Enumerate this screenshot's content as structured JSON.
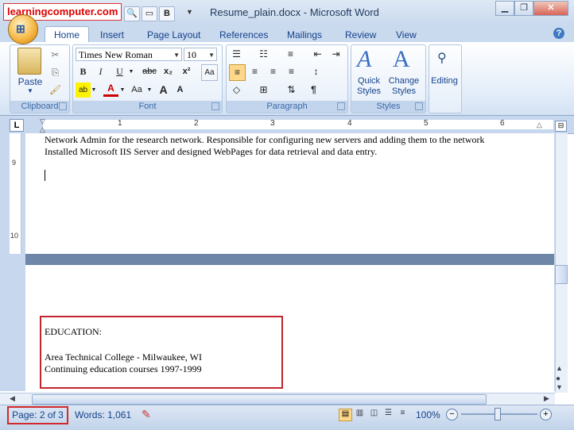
{
  "title_bar": {
    "watermark": "learningcomputer.com",
    "document_title": "Resume_plain.docx - Microsoft Word",
    "qat_bold": "B",
    "window_controls": [
      "minimize-icon",
      "restore-icon",
      "close-icon"
    ]
  },
  "ribbon_tabs": [
    "Home",
    "Insert",
    "Page Layout",
    "References",
    "Mailings",
    "Review",
    "View"
  ],
  "clipboard": {
    "paste_label": "Paste",
    "group_label": "Clipboard"
  },
  "font": {
    "font_name": "Times New Roman",
    "font_size": "10",
    "bold": "B",
    "italic": "I",
    "underline": "U",
    "strikethrough": "abc",
    "subscript": "x₂",
    "superscript": "x²",
    "group_label": "Font"
  },
  "paragraph": {
    "group_label": "Paragraph",
    "show_marks": "¶"
  },
  "styles": {
    "quick_styles": "Quick Styles",
    "change_styles": "Change Styles",
    "group_label": "Styles"
  },
  "editing": {
    "label": "Editing"
  },
  "ruler": {
    "ticks": [
      "1",
      "2",
      "3",
      "4",
      "5",
      "6"
    ],
    "vertical_ticks": [
      "9",
      "10"
    ]
  },
  "document": {
    "page1_lines": [
      "Network Admin for the research network. Responsible for configuring new servers and adding them to the network",
      "Installed Microsoft IIS Server and designed WebPages for data retrieval and data entry."
    ],
    "education_heading": "EDUCATION:",
    "education_lines": [
      "Area Technical College  - Milwaukee, WI",
      "Continuing education courses 1997-1999"
    ]
  },
  "status_bar": {
    "page": "Page: 2 of 3",
    "words": "Words: 1,061",
    "zoom": "100%"
  }
}
